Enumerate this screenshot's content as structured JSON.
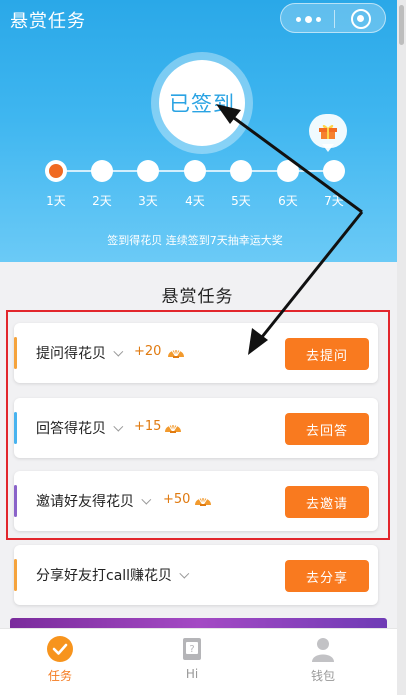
{
  "header": {
    "title": "悬赏任务",
    "more_icon": "more-dots-icon",
    "close_icon": "target-circle-icon"
  },
  "checkin": {
    "status": "已签到",
    "days": [
      "1天",
      "2天",
      "3天",
      "4天",
      "5天",
      "6天",
      "7天"
    ],
    "current_day": 1,
    "gift_icon": "gift-icon",
    "hint": "签到得花贝 连续签到7天抽幸运大奖"
  },
  "section": {
    "title": "悬赏任务"
  },
  "tasks": [
    {
      "name": "提问得花贝",
      "reward": "+20",
      "button": "去提问",
      "accent": "#f5a33c"
    },
    {
      "name": "回答得花贝",
      "reward": "+15",
      "button": "去回答",
      "accent": "#48b3ef"
    },
    {
      "name": "邀请好友得花贝",
      "reward": "+50",
      "button": "去邀请",
      "accent": "#8a63c9"
    },
    {
      "name": "分享好友打call赚花贝",
      "reward": "",
      "button": "去分享",
      "accent": "#f5a33c"
    }
  ],
  "tabbar": {
    "items": [
      {
        "label": "任务",
        "icon": "task-check-icon",
        "active": true
      },
      {
        "label": "Hi",
        "icon": "hi-card-icon",
        "active": false
      },
      {
        "label": "钱包",
        "icon": "wallet-user-icon",
        "active": false
      }
    ]
  },
  "colors": {
    "primary_blue": "#2aa8e8",
    "accent_orange": "#f97a1f",
    "highlight_red": "#e2262c"
  }
}
